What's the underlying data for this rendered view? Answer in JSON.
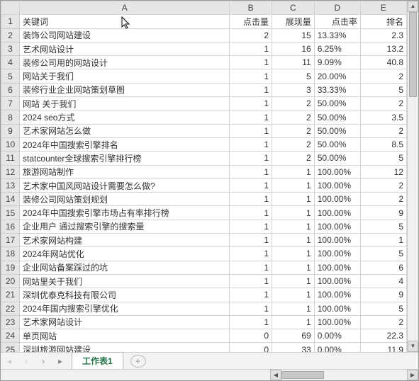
{
  "columns": [
    "A",
    "B",
    "C",
    "D",
    "E"
  ],
  "headerRow": {
    "keyword": "关键词",
    "clicks": "点击量",
    "impressions": "展现量",
    "ctr": "点击率",
    "rank": "排名"
  },
  "rows": [
    {
      "n": 1,
      "A": "关键词",
      "B": "点击量",
      "C": "展现量",
      "D": "点击率",
      "E": "排名"
    },
    {
      "n": 2,
      "A": "装饰公司网站建设",
      "B": "2",
      "C": "15",
      "D": "13.33%",
      "E": "2.3"
    },
    {
      "n": 3,
      "A": "艺术网站设计",
      "B": "1",
      "C": "16",
      "D": "6.25%",
      "E": "13.2"
    },
    {
      "n": 4,
      "A": "装修公司用的网站设计",
      "B": "1",
      "C": "11",
      "D": "9.09%",
      "E": "40.8"
    },
    {
      "n": 5,
      "A": "网站关于我们",
      "B": "1",
      "C": "5",
      "D": "20.00%",
      "E": "2"
    },
    {
      "n": 6,
      "A": "装修行业企业网站策划草图",
      "B": "1",
      "C": "3",
      "D": "33.33%",
      "E": "5"
    },
    {
      "n": 7,
      "A": "网站 关于我们",
      "B": "1",
      "C": "2",
      "D": "50.00%",
      "E": "2"
    },
    {
      "n": 8,
      "A": "2024 seo方式",
      "B": "1",
      "C": "2",
      "D": "50.00%",
      "E": "3.5"
    },
    {
      "n": 9,
      "A": "艺术家网站怎么做",
      "B": "1",
      "C": "2",
      "D": "50.00%",
      "E": "2"
    },
    {
      "n": 10,
      "A": "2024年中国搜索引擎排名",
      "B": "1",
      "C": "2",
      "D": "50.00%",
      "E": "8.5"
    },
    {
      "n": 11,
      "A": "statcounter全球搜索引擎排行榜",
      "B": "1",
      "C": "2",
      "D": "50.00%",
      "E": "5"
    },
    {
      "n": 12,
      "A": "旅游网站制作",
      "B": "1",
      "C": "1",
      "D": "100.00%",
      "E": "12"
    },
    {
      "n": 13,
      "A": "艺术家中国风网站设计需要怎么做?",
      "B": "1",
      "C": "1",
      "D": "100.00%",
      "E": "2"
    },
    {
      "n": 14,
      "A": "装修公司网站策划规划",
      "B": "1",
      "C": "1",
      "D": "100.00%",
      "E": "2"
    },
    {
      "n": 15,
      "A": "2024年中国搜索引擎市场占有率排行榜",
      "B": "1",
      "C": "1",
      "D": "100.00%",
      "E": "9"
    },
    {
      "n": 16,
      "A": "企业用户 通过搜索引擎的搜索量",
      "B": "1",
      "C": "1",
      "D": "100.00%",
      "E": "5"
    },
    {
      "n": 17,
      "A": "艺术家网站构建",
      "B": "1",
      "C": "1",
      "D": "100.00%",
      "E": "1"
    },
    {
      "n": 18,
      "A": "2024年网站优化",
      "B": "1",
      "C": "1",
      "D": "100.00%",
      "E": "5"
    },
    {
      "n": 19,
      "A": "企业网站备案踩过的坑",
      "B": "1",
      "C": "1",
      "D": "100.00%",
      "E": "6"
    },
    {
      "n": 20,
      "A": "网站里关于我们",
      "B": "1",
      "C": "1",
      "D": "100.00%",
      "E": "4"
    },
    {
      "n": 21,
      "A": "深圳优泰克科技有限公司",
      "B": "1",
      "C": "1",
      "D": "100.00%",
      "E": "9"
    },
    {
      "n": 22,
      "A": "2024年国内搜索引擎优化",
      "B": "1",
      "C": "1",
      "D": "100.00%",
      "E": "5"
    },
    {
      "n": 23,
      "A": "艺术家网站设计",
      "B": "1",
      "C": "1",
      "D": "100.00%",
      "E": "2"
    },
    {
      "n": 24,
      "A": "单页网站",
      "B": "0",
      "C": "69",
      "D": "0.00%",
      "E": "22.3"
    },
    {
      "n": 25,
      "A": "深圳旅游网站建设",
      "B": "0",
      "C": "33",
      "D": "0.00%",
      "E": "11.9"
    }
  ],
  "tab": "工作表1",
  "addTab": "+",
  "chart_data": {
    "type": "table",
    "columns": [
      "关键词",
      "点击量",
      "展现量",
      "点击率",
      "排名"
    ],
    "data": [
      [
        "装饰公司网站建设",
        2,
        15,
        "13.33%",
        2.3
      ],
      [
        "艺术网站设计",
        1,
        16,
        "6.25%",
        13.2
      ],
      [
        "装修公司用的网站设计",
        1,
        11,
        "9.09%",
        40.8
      ],
      [
        "网站关于我们",
        1,
        5,
        "20.00%",
        2
      ],
      [
        "装修行业企业网站策划草图",
        1,
        3,
        "33.33%",
        5
      ],
      [
        "网站 关于我们",
        1,
        2,
        "50.00%",
        2
      ],
      [
        "2024 seo方式",
        1,
        2,
        "50.00%",
        3.5
      ],
      [
        "艺术家网站怎么做",
        1,
        2,
        "50.00%",
        2
      ],
      [
        "2024年中国搜索引擎排名",
        1,
        2,
        "50.00%",
        8.5
      ],
      [
        "statcounter全球搜索引擎排行榜",
        1,
        2,
        "50.00%",
        5
      ],
      [
        "旅游网站制作",
        1,
        1,
        "100.00%",
        12
      ],
      [
        "艺术家中国风网站设计需要怎么做?",
        1,
        1,
        "100.00%",
        2
      ],
      [
        "装修公司网站策划规划",
        1,
        1,
        "100.00%",
        2
      ],
      [
        "2024年中国搜索引擎市场占有率排行榜",
        1,
        1,
        "100.00%",
        9
      ],
      [
        "企业用户 通过搜索引擎的搜索量",
        1,
        1,
        "100.00%",
        5
      ],
      [
        "艺术家网站构建",
        1,
        1,
        "100.00%",
        1
      ],
      [
        "2024年网站优化",
        1,
        1,
        "100.00%",
        5
      ],
      [
        "企业网站备案踩过的坑",
        1,
        1,
        "100.00%",
        6
      ],
      [
        "网站里关于我们",
        1,
        1,
        "100.00%",
        4
      ],
      [
        "深圳优泰克科技有限公司",
        1,
        1,
        "100.00%",
        9
      ],
      [
        "2024年国内搜索引擎优化",
        1,
        1,
        "100.00%",
        5
      ],
      [
        "艺术家网站设计",
        1,
        1,
        "100.00%",
        2
      ],
      [
        "单页网站",
        0,
        69,
        "0.00%",
        22.3
      ],
      [
        "深圳旅游网站建设",
        0,
        33,
        "0.00%",
        11.9
      ]
    ]
  }
}
